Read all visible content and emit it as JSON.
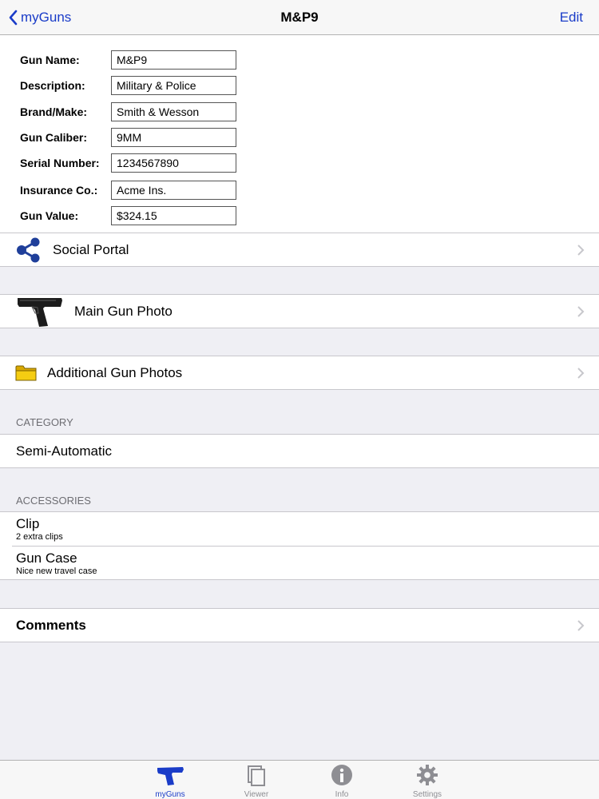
{
  "nav": {
    "back_label": "myGuns",
    "title": "M&P9",
    "edit_label": "Edit"
  },
  "form": {
    "fields": [
      {
        "label": "Gun Name:",
        "value": "M&P9"
      },
      {
        "label": "Description:",
        "value": "Military & Police"
      },
      {
        "label": "Brand/Make:",
        "value": "Smith & Wesson"
      },
      {
        "label": "Gun Caliber:",
        "value": "9MM"
      },
      {
        "label": "Serial Number:",
        "value": "1234567890"
      },
      {
        "label": "Insurance Co.:",
        "value": "Acme Ins."
      },
      {
        "label": "Gun Value:",
        "value": "$324.15"
      }
    ]
  },
  "rows": {
    "social_portal": {
      "label": "Social Portal",
      "icon": "share-network-icon"
    },
    "main_photo": {
      "label": "Main Gun Photo",
      "icon": "pistol-thumbnail"
    },
    "additional_photos": {
      "label": "Additional Gun Photos",
      "icon": "folder-icon"
    }
  },
  "category": {
    "header": "CATEGORY",
    "value": "Semi-Automatic"
  },
  "accessories": {
    "header": "ACCESSORIES",
    "items": [
      {
        "title": "Clip",
        "detail": "2 extra clips"
      },
      {
        "title": "Gun Case",
        "detail": "Nice new travel case"
      }
    ]
  },
  "comments": {
    "label": "Comments"
  },
  "tabbar": {
    "tabs": [
      {
        "label": "myGuns",
        "icon": "pistol-icon",
        "active": true
      },
      {
        "label": "Viewer",
        "icon": "viewer-icon",
        "active": false
      },
      {
        "label": "Info",
        "icon": "info-icon",
        "active": false
      },
      {
        "label": "Settings",
        "icon": "gear-icon",
        "active": false
      }
    ]
  },
  "colors": {
    "accent": "#1a3cc8",
    "background": "#efeff4",
    "separator": "#c8c7cc",
    "folder_yellow": "#f2c400"
  }
}
